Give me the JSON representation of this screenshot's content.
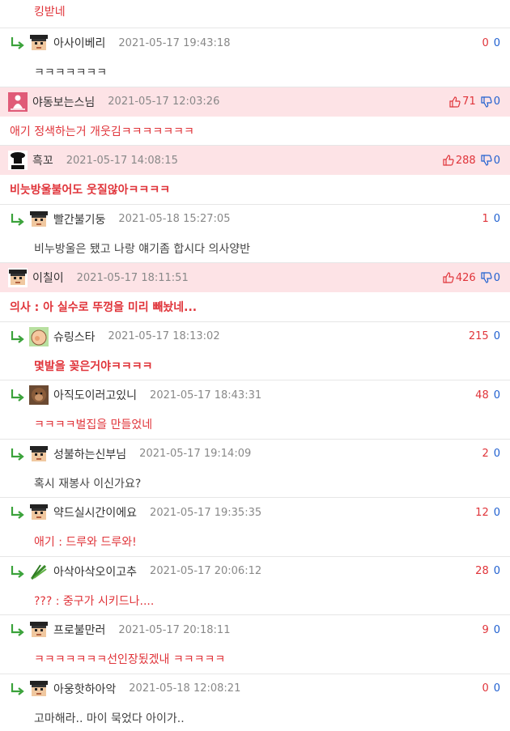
{
  "colors": {
    "accent_red": "#e0343a",
    "accent_blue": "#2060d0",
    "best_bg": "#fde3e6",
    "reply_arrow": "#3aa23a"
  },
  "top_fragment": {
    "content": "킹받네"
  },
  "comments": [
    {
      "kind": "reply",
      "avatar": "pixel-face-icon",
      "nick": "아사이베리",
      "time": "2021-05-17 19:43:18",
      "up": "0",
      "down": "0",
      "content": "ㅋㅋㅋㅋㅋㅋㅋ",
      "style": "normal"
    },
    {
      "kind": "best",
      "avatar": "buddha-icon",
      "nick": "야동보는스님",
      "time": "2021-05-17 12:03:26",
      "up": "71",
      "down": "0",
      "content": "애기 정색하는거 개웃김ㅋㅋㅋㅋㅋㅋㅋ",
      "style": "red"
    },
    {
      "kind": "best",
      "avatar": "chef-icon",
      "nick": "흑꼬",
      "time": "2021-05-17 14:08:15",
      "up": "288",
      "down": "0",
      "content": "비늣방울불어도 웃질않아ㅋㅋㅋㅋ",
      "style": "red-bold"
    },
    {
      "kind": "reply",
      "avatar": "pixel-face-icon",
      "nick": "빨간불기둥",
      "time": "2021-05-18 15:27:05",
      "up": "1",
      "down": "0",
      "content": "비누방울은 됐고 나랑 얘기좀 합시다 의사양반",
      "style": "normal"
    },
    {
      "kind": "best",
      "avatar": "pixel-face-icon",
      "nick": "이칠이",
      "time": "2021-05-17 18:11:51",
      "up": "426",
      "down": "0",
      "content": "의사 : 아 실수로 뚜껑을 미리 빼놨네...",
      "style": "red-bold"
    },
    {
      "kind": "reply",
      "avatar": "cartoon-face-icon",
      "nick": "슈링스타",
      "time": "2021-05-17 18:13:02",
      "up": "215",
      "down": "0",
      "content": "몇발을 꽂은거야ㅋㅋㅋㅋ",
      "style": "red-bold"
    },
    {
      "kind": "reply",
      "avatar": "monkey-icon",
      "nick": "아직도이러고있니",
      "time": "2021-05-17 18:43:31",
      "up": "48",
      "down": "0",
      "content": "ㅋㅋㅋㅋ벌집을 만들었네",
      "style": "red"
    },
    {
      "kind": "reply",
      "avatar": "pixel-face-icon",
      "nick": "성불하는신부님",
      "time": "2021-05-17 19:14:09",
      "up": "2",
      "down": "0",
      "content": "혹시 재봉사 이신가요?",
      "style": "normal"
    },
    {
      "kind": "reply",
      "avatar": "pixel-face-icon",
      "nick": "약드실시간이에요",
      "time": "2021-05-17 19:35:35",
      "up": "12",
      "down": "0",
      "content": "애기 : 드루와 드루와!",
      "style": "red"
    },
    {
      "kind": "reply",
      "avatar": "green-onion-icon",
      "nick": "아삭아삭오이고추",
      "time": "2021-05-17 20:06:12",
      "up": "28",
      "down": "0",
      "content": "??? : 중구가 시키드나....",
      "style": "red"
    },
    {
      "kind": "reply",
      "avatar": "pixel-face-icon",
      "nick": "프로불만러",
      "time": "2021-05-17 20:18:11",
      "up": "9",
      "down": "0",
      "content": "ㅋㅋㅋㅋㅋㅋㅋ선인장됬겠내 ㅋㅋㅋㅋㅋ",
      "style": "red"
    },
    {
      "kind": "reply",
      "avatar": "pixel-face-icon",
      "nick": "아웅핫하아악",
      "time": "2021-05-18 12:08:21",
      "up": "0",
      "down": "0",
      "content": "고마해라.. 마이 묵었다 아이가..",
      "style": "normal"
    }
  ]
}
